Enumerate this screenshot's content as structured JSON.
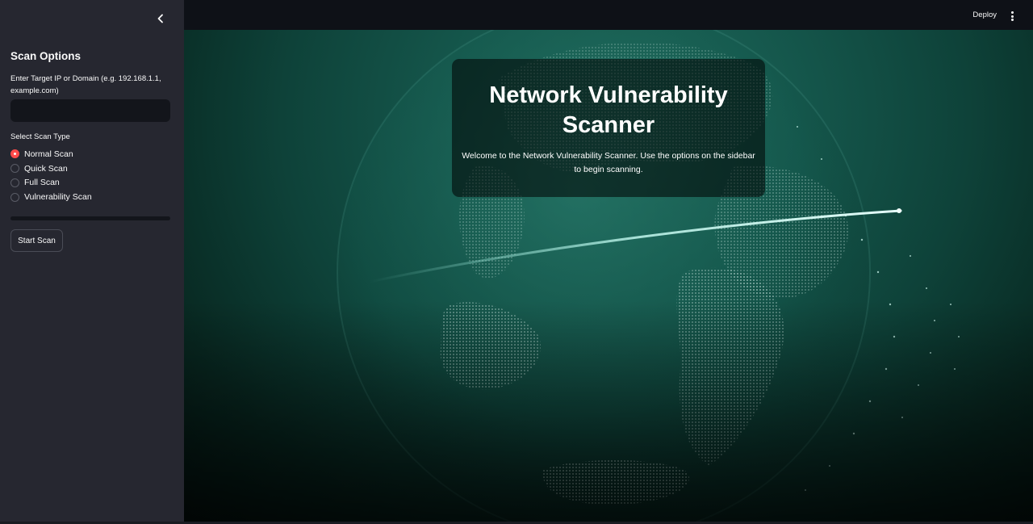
{
  "sidebar": {
    "collapse_icon": "chevron-left-icon",
    "title": "Scan Options",
    "target_label": "Enter Target IP or Domain (e.g. 192.168.1.1, example.com)",
    "target_value": "",
    "scan_type_label": "Select Scan Type",
    "scan_types": [
      "Normal Scan",
      "Quick Scan",
      "Full Scan",
      "Vulnerability Scan"
    ],
    "selected_scan_type": "Normal Scan",
    "progress_fraction": 0,
    "start_button": "Start Scan"
  },
  "header": {
    "deploy_label": "Deploy",
    "menu_icon": "more-vertical-icon"
  },
  "main": {
    "background": "globe-network-image",
    "title": "Network Vulnerability Scanner",
    "subtitle": "Welcome to the Network Vulnerability Scanner. Use the options on the sidebar to begin scanning."
  },
  "colors": {
    "accent": "#ff4b4b",
    "sidebar_bg": "#262730",
    "app_bg": "#0e1117",
    "globe_teal": "#15574c"
  }
}
